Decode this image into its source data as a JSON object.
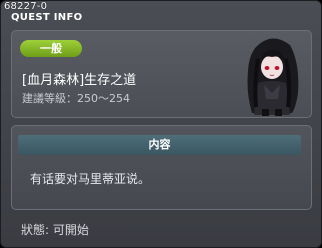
{
  "header": {
    "id": "68227-0",
    "title": "QUEST INFO"
  },
  "quest": {
    "category": "一般",
    "name": "[血月森林]生存之道",
    "level": "建議等級：250～254"
  },
  "content": {
    "header": "内容",
    "text": "有话要对马里蒂亚说。"
  },
  "status": {
    "label": "狀態:",
    "value": "可開始"
  },
  "colors": {
    "badge": "#8bbf2a",
    "content_header": "#44626d",
    "window": "#44464c"
  },
  "icons": {
    "npc": "dark-haired-npc-portrait"
  }
}
